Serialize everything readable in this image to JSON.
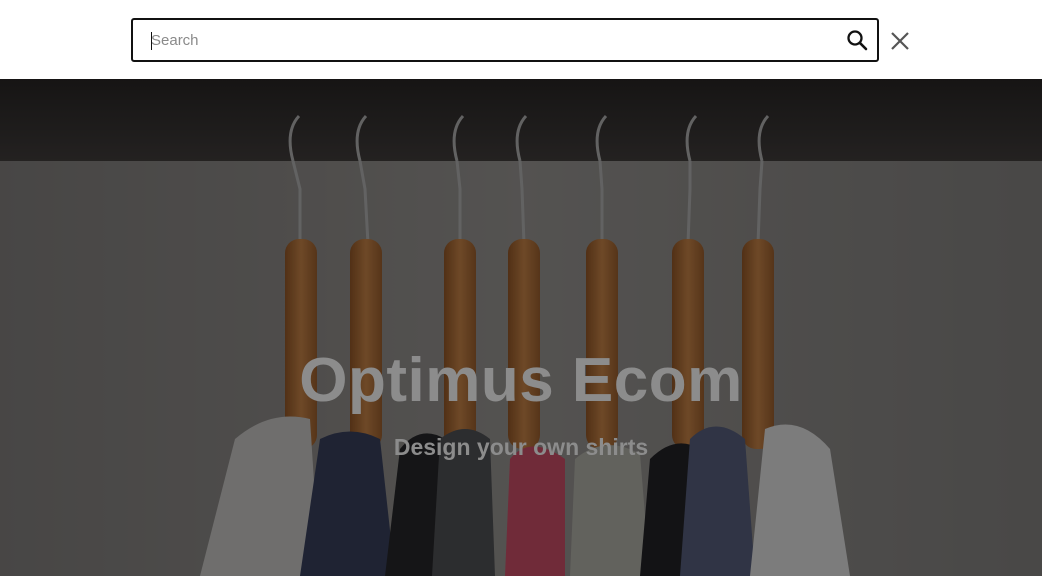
{
  "search": {
    "placeholder": "Search",
    "value": "",
    "submit_icon": "search-icon",
    "close_icon": "close-icon"
  },
  "hero": {
    "title": "Optimus Ecom",
    "subtitle": "Design your own shirts",
    "image_icon": "hanging-shirts-photo"
  },
  "colors": {
    "header_bg": "#ffffff",
    "field_border": "#111111",
    "hero_text": "#8c8c8c",
    "close_icon": "#555555"
  }
}
